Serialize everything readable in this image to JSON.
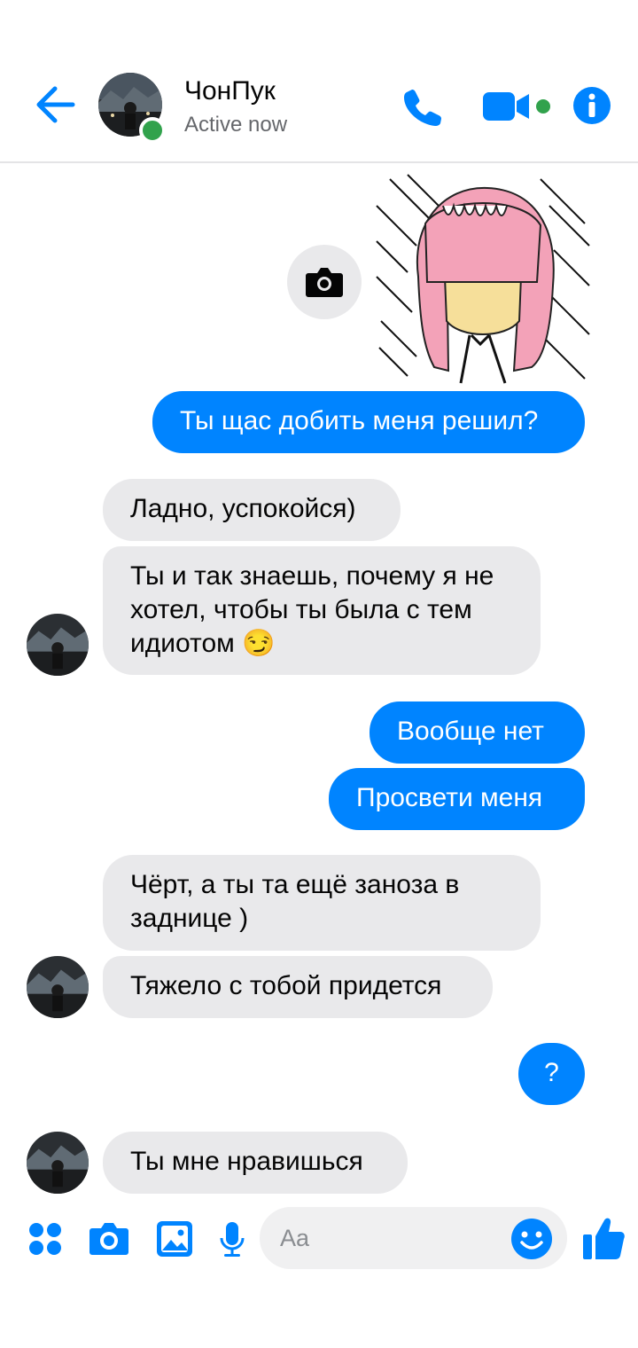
{
  "header": {
    "contact_name": "ЧонПук",
    "status": "Active now"
  },
  "icons": {
    "back": "back-arrow-icon",
    "call": "phone-icon",
    "video": "video-camera-icon",
    "info": "info-icon",
    "camera": "camera-icon",
    "apps": "apps-grid-icon",
    "image": "image-icon",
    "mic": "microphone-icon",
    "emoji": "smiley-icon",
    "like": "thumbs-up-icon"
  },
  "colors": {
    "accent": "#0084ff",
    "incoming_bubble": "#e9e9eb",
    "online": "#31a24c"
  },
  "messages": [
    {
      "id": "m1",
      "direction": "out",
      "text": "Ты щас добить меня решил?"
    },
    {
      "id": "m2",
      "direction": "in",
      "text": "Ладно, успокойся)"
    },
    {
      "id": "m3",
      "direction": "in",
      "text": "Ты и так знаешь, почему я не хотел, чтобы ты была с тем идиотом 😏"
    },
    {
      "id": "m4",
      "direction": "out",
      "text": "Вообще нет"
    },
    {
      "id": "m5",
      "direction": "out",
      "text": "Просвети меня"
    },
    {
      "id": "m6",
      "direction": "in",
      "text": "Чёрт, а ты та ещё заноза в заднице )"
    },
    {
      "id": "m7",
      "direction": "in",
      "text": "Тяжело с тобой придется"
    },
    {
      "id": "m8",
      "direction": "out",
      "text": "?"
    },
    {
      "id": "m9",
      "direction": "in",
      "text": "Ты мне нравишься"
    }
  ],
  "composer": {
    "placeholder": "Aa"
  }
}
